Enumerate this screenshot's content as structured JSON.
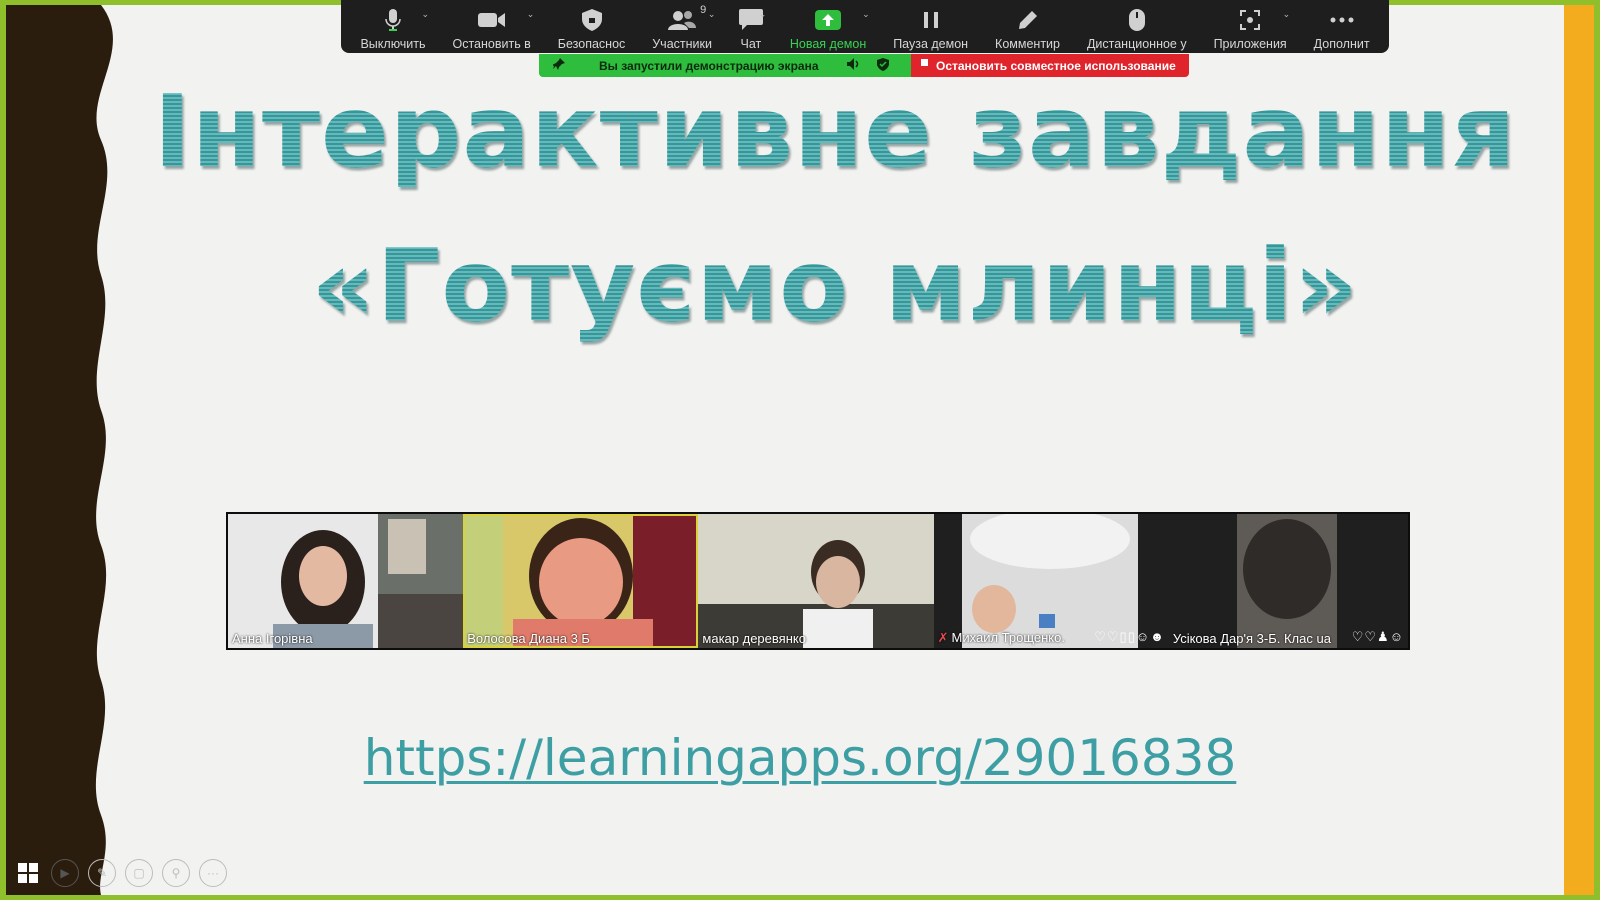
{
  "colors": {
    "frame_green": "#8fbf2a",
    "left_band": "#2b1d0e",
    "right_band": "#f4ac1f",
    "title_teal": "#4aa5a8",
    "link_teal": "#3d9fa3"
  },
  "toolbar": {
    "buttons": [
      {
        "id": "mute",
        "icon": "microphone-icon",
        "label": "Выключить",
        "has_caret": true
      },
      {
        "id": "video",
        "icon": "video-camera-icon",
        "label": "Остановить в",
        "has_caret": true
      },
      {
        "id": "security",
        "icon": "shield-icon",
        "label": "Безопаснос",
        "has_caret": false
      },
      {
        "id": "participants",
        "icon": "participants-icon",
        "label": "Участники",
        "count": "9",
        "has_caret": true
      },
      {
        "id": "chat",
        "icon": "chat-bubble-icon",
        "label": "Чат",
        "has_caret": true
      },
      {
        "id": "new-share",
        "icon": "share-screen-icon",
        "label": "Новая демон",
        "has_caret": true
      },
      {
        "id": "pause-share",
        "icon": "pause-icon",
        "label": "Пауза демон",
        "has_caret": false
      },
      {
        "id": "annotate",
        "icon": "pencil-icon",
        "label": "Комментир",
        "has_caret": false
      },
      {
        "id": "remote-control",
        "icon": "mouse-icon",
        "label": "Дистанционное у",
        "has_caret": false
      },
      {
        "id": "apps",
        "icon": "apps-icon",
        "label": "Приложения",
        "has_caret": true
      },
      {
        "id": "more",
        "icon": "more-dots-icon",
        "label": "Дополнит",
        "has_caret": false
      }
    ]
  },
  "share_banner": {
    "message": "Вы запустили демонстрацию экрана",
    "stop_label": "Остановить совместное использование"
  },
  "slide": {
    "title_line1": "Інтерактивне завдання",
    "title_line2": "«Готуємо млинці»",
    "link": "https://learningapps.org/29016838"
  },
  "video_tiles": [
    {
      "name": "Анна Ігорівна",
      "active": false
    },
    {
      "name": "Волосова Диана 3 Б",
      "active": true
    },
    {
      "name": "макар  деревянко",
      "active": false
    },
    {
      "name": "Михаил Трощенко.",
      "muted": true,
      "reactions": "♡♡▯▯☺☻",
      "active": false
    },
    {
      "name": "Усікова Дар'я 3-Б. Клас",
      "suffix": "ua",
      "reactions": "♡♡♟☺",
      "active": false
    }
  ],
  "slideshow_controls": [
    "windows-icon",
    "play-icon",
    "pen-icon",
    "slides-icon",
    "zoom-icon",
    "more-icon"
  ]
}
